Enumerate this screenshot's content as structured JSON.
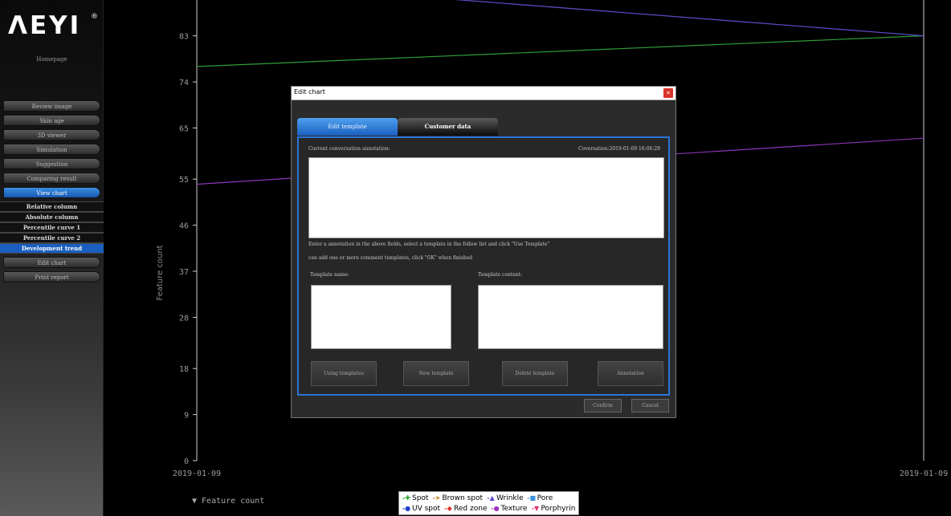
{
  "brand": {
    "logo_text": "ΛEYI",
    "reg": "®"
  },
  "sidebar": {
    "homepage": "Homepage",
    "nav_top": [
      "Review image",
      "Skin age",
      "3D viewer",
      "Simulation",
      "Suggestion",
      "Comparing result"
    ],
    "view_chart": "View chart",
    "sub_items": [
      "Relative column",
      "Absolute column",
      "Percentile curve 1",
      "Percentile curve 2",
      "Development trend"
    ],
    "nav_bottom": [
      "Edit chart",
      "Print report"
    ]
  },
  "chart": {
    "ylabel": "Feature count",
    "series_toggle": "▼ Feature count"
  },
  "chart_data": {
    "type": "line",
    "ylabel": "Feature count",
    "x": [
      "2019-01-09",
      "2019-01-09"
    ],
    "y_ticks": [
      0,
      9,
      18,
      28,
      37,
      46,
      55,
      65,
      74,
      83
    ],
    "ylim": [
      0,
      90
    ],
    "grid": false,
    "legend_position": "bottom-center",
    "series": [
      {
        "name": "Spot",
        "color": "#2e9e3a",
        "values": [
          77,
          83
        ]
      },
      {
        "name": "Wrinkle",
        "color": "#5b4fd0",
        "values": [
          94,
          83
        ]
      },
      {
        "name": "Texture",
        "color": "#8b35b8",
        "values": [
          54,
          63
        ]
      }
    ]
  },
  "legend": {
    "row1": [
      {
        "label": "Spot",
        "color": "#20a020",
        "mark": "✚"
      },
      {
        "label": "Brown spot",
        "color": "#d08020",
        "mark": "➤"
      },
      {
        "label": "Wrinkle",
        "color": "#6040d0",
        "mark": "▲"
      },
      {
        "label": "Pore",
        "color": "#3a90e0",
        "mark": "■"
      }
    ],
    "row2": [
      {
        "label": "UV spot",
        "color": "#2040d0",
        "mark": "●"
      },
      {
        "label": "Red zone",
        "color": "#e03030",
        "mark": "◆"
      },
      {
        "label": "Texture",
        "color": "#a030c0",
        "mark": "●"
      },
      {
        "label": "Porphyrin",
        "color": "#e0306a",
        "mark": "▼"
      }
    ]
  },
  "modal": {
    "title": "Edit chart",
    "close": "×",
    "tabs": [
      "Edit template",
      "Customer data"
    ],
    "current_annotation_label": "Current conversation annotation:",
    "conversation_time": "Coversation:2019-01-09 16:06:29",
    "instructions_1": "Enter a annotation in the above fields, select a template in the follow list and click \"Use Template\"",
    "instructions_2": "can add one or more comment templates, click \"OK\" when finished",
    "template_name_label": "Template name:",
    "template_content_label": "Template content:",
    "buttons": [
      "Using templates",
      "New template",
      "Delete template",
      "Annotation"
    ],
    "confirm": "Confirm",
    "cancel": "Cancel"
  }
}
